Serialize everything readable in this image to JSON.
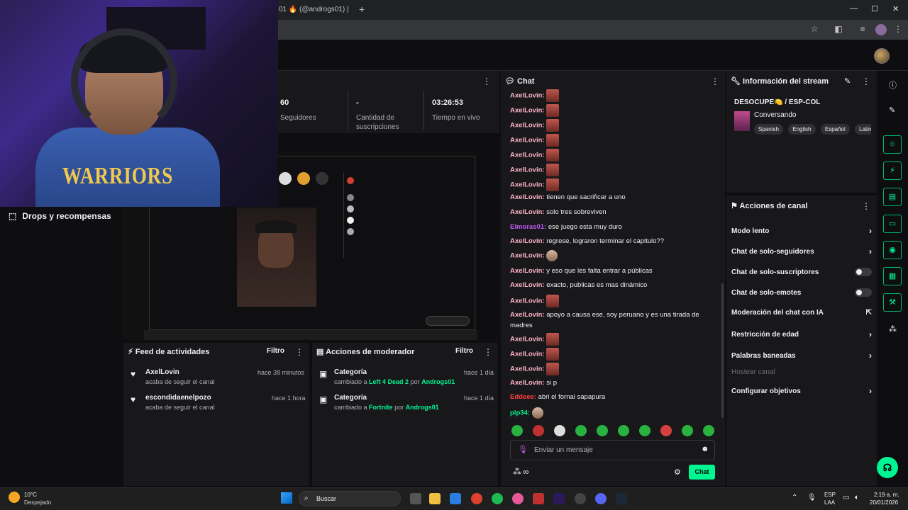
{
  "browser": {
    "tab_title": "01 🔥 (@androgs01) |",
    "new_tab": "+",
    "minimize": "—",
    "maximize": "☐",
    "close": "✕"
  },
  "webcam": {
    "jersey_text": "WARRIORS"
  },
  "left_nav": {
    "drops_label": "Drops y recompensas"
  },
  "stats": {
    "followers_value": "60",
    "followers_label": "Seguidores",
    "subs_value": "-",
    "subs_label_1": "Cantidad de",
    "subs_label_2": "suscripciones",
    "live_value": "03:26:53",
    "live_label": "Tiempo en vivo"
  },
  "chat": {
    "title": "Chat",
    "messages": [
      {
        "user": "AxelLovin:",
        "text": "",
        "emote": true
      },
      {
        "user": "AxelLovin:",
        "text": "",
        "emote": true
      },
      {
        "user": "AxelLovin:",
        "text": "",
        "emote": true
      },
      {
        "user": "AxelLovin:",
        "text": "",
        "emote": true
      },
      {
        "user": "AxelLovin:",
        "text": "",
        "emote": true
      },
      {
        "user": "AxelLovin:",
        "text": "",
        "emote": true
      },
      {
        "user": "AxelLovin:",
        "text": "",
        "emote": true
      },
      {
        "user": "AxelLovin:",
        "text": "tienen que sacrificar a uno"
      },
      {
        "user": "AxelLovin:",
        "text": "solo tres sobreviven"
      },
      {
        "user": "Elmoras01:",
        "text": "ese juego esta muy duro",
        "color": "#bf5af2"
      },
      {
        "user": "AxelLovin:",
        "text": "regrese, lograron terminar el capitulo??"
      },
      {
        "user": "AxelLovin:",
        "text": "",
        "emote": true,
        "small": true
      },
      {
        "user": "AxelLovin:",
        "text": "y eso que les falta entrar a públicas"
      },
      {
        "user": "AxelLovin:",
        "text": "exacto, publicas es mas dinámico"
      },
      {
        "user": "AxelLovin:",
        "text": "",
        "emote": true
      },
      {
        "user": "AxelLovin:",
        "text": "apoyo a causa ese, soy peruano y es una tirada de madres"
      },
      {
        "user": "AxelLovin:",
        "text": "",
        "emote": true
      },
      {
        "user": "AxelLovin:",
        "text": "",
        "emote": true
      },
      {
        "user": "AxelLovin:",
        "text": "",
        "emote": true
      },
      {
        "user": "AxelLovin:",
        "text": "si p"
      },
      {
        "user": "Eddeee:",
        "text": "abri el fornai sapapura",
        "color": "#ff4040"
      },
      {
        "user": "pip34:",
        "text": "",
        "emote": true,
        "small": true,
        "color": "#00f593"
      }
    ],
    "input_placeholder": "Enviar un mensaje",
    "send_label": "Chat",
    "points_label": "∞"
  },
  "stream_info": {
    "title": "Información del stream",
    "stream_title": "DESOCUPE🍋 / ESP-COL",
    "category": "Conversando",
    "tags": [
      "Spanish",
      "English",
      "Español",
      "Latin"
    ]
  },
  "channel_actions": {
    "title": "Acciones de canal",
    "items": [
      {
        "label": "Modo lento",
        "control": "chevron"
      },
      {
        "label": "Chat de solo-seguidores",
        "control": "chevron"
      },
      {
        "label": "Chat de solo-suscriptores",
        "control": "toggle"
      },
      {
        "label": "Chat de solo-emotes",
        "control": "toggle"
      },
      {
        "label": "Moderación del chat con IA",
        "control": "external"
      },
      {
        "label": "Restricción de edad",
        "control": "chevron"
      },
      {
        "label": "Palabras baneadas",
        "control": "chevron"
      },
      {
        "label": "Hostear canal",
        "control": "none"
      },
      {
        "label": "Configurar objetivos",
        "control": "chevron"
      }
    ]
  },
  "activity_feed": {
    "title": "Feed de actividades",
    "filter": "Filtro",
    "items": [
      {
        "user": "AxelLovin",
        "action": "acaba de seguir el canal",
        "time": "hace 38 minutos"
      },
      {
        "user": "escondidaenelpozo",
        "action": "acaba de seguir el canal",
        "time": "hace 1 hora"
      }
    ]
  },
  "mod_actions": {
    "title": "Acciones de moderador",
    "filter": "Filtro",
    "items": [
      {
        "label": "Categoría",
        "changed": "cambiado a",
        "value": "Left 4 Dead 2",
        "by": "por",
        "who": "Androgs01",
        "time": "hace 1 día"
      },
      {
        "label": "Categoría",
        "changed": "cambiado a",
        "value": "Fortnite",
        "by": "por",
        "who": "Androgs01",
        "time": "hace 1 día"
      }
    ]
  },
  "taskbar": {
    "temp": "10°C",
    "weather": "Despejado",
    "search": "Buscar",
    "lang_1": "ESP",
    "lang_2": "LAA",
    "time": "2:19 a. m.",
    "date": "20/01/2026"
  }
}
